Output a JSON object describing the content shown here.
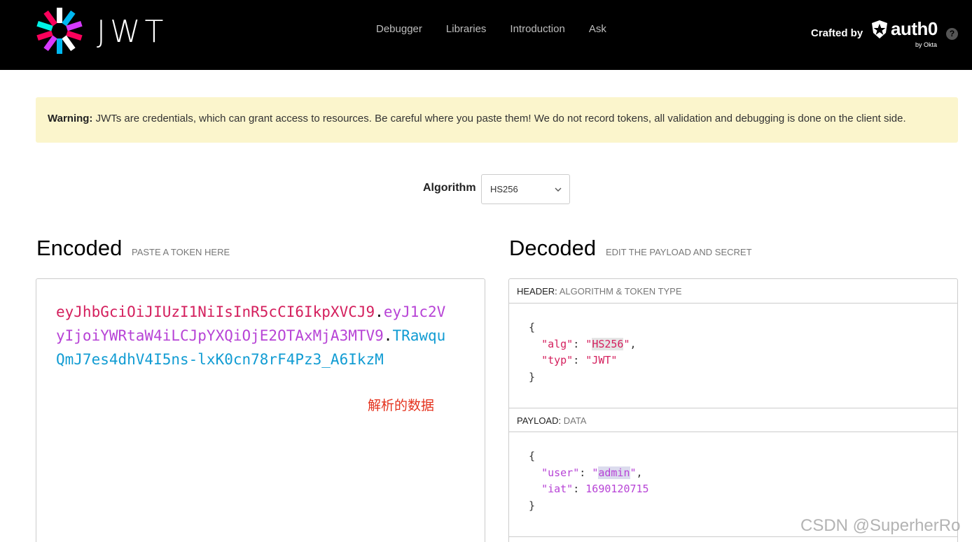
{
  "nav": {
    "logo_text": "JWT",
    "items": [
      {
        "label": "Debugger"
      },
      {
        "label": "Libraries"
      },
      {
        "label": "Introduction"
      },
      {
        "label": "Ask"
      }
    ],
    "crafted_by": "Crafted by",
    "brand": "auth0",
    "brand_sub": "by Okta",
    "help_icon": "?"
  },
  "warning": {
    "strong": "Warning:",
    "text": " JWTs are credentials, which can grant access to resources. Be careful where you paste them! We do not record tokens, all validation and debugging is done on the client side."
  },
  "algorithm": {
    "label": "Algorithm",
    "selected": "HS256"
  },
  "encoded": {
    "title": "Encoded",
    "subtitle": "PASTE A TOKEN HERE",
    "header_part": "eyJhbGciOiJIUzI1NiIsInR5cCI6IkpXVCJ9",
    "payload_part": "eyJ1c2VyIjoiYWRtaW4iLCJpYXQiOjE2OTAxMjA3MTV9",
    "signature_part": "TRawquQmJ7es4dhV4I5ns-lxK0cn78rF4Pz3_A6IkzM",
    "dot": ".",
    "annotation": "解析的数据"
  },
  "decoded": {
    "title": "Decoded",
    "subtitle": "EDIT THE PAYLOAD AND SECRET",
    "header_panel": {
      "key": "HEADER:",
      "value": "ALGORITHM & TOKEN TYPE"
    },
    "payload_panel": {
      "key": "PAYLOAD:",
      "value": "DATA"
    },
    "header_json": {
      "open": "{",
      "alg_key": "\"alg\"",
      "alg_value": "HS256",
      "typ_key": "\"typ\"",
      "typ_value": "\"JWT\"",
      "close": "}"
    },
    "payload_json": {
      "open": "{",
      "user_key": "\"user\"",
      "user_value": "admin",
      "iat_key": "\"iat\"",
      "iat_value": "1690120715",
      "close": "}"
    }
  },
  "watermark": "CSDN @SuperherRo",
  "colors": {
    "token_header": "#d41f5d",
    "token_payload": "#b743d6",
    "token_signature": "#119cd3",
    "warning_bg": "#fbf5cc",
    "annotation": "#e4321d"
  }
}
